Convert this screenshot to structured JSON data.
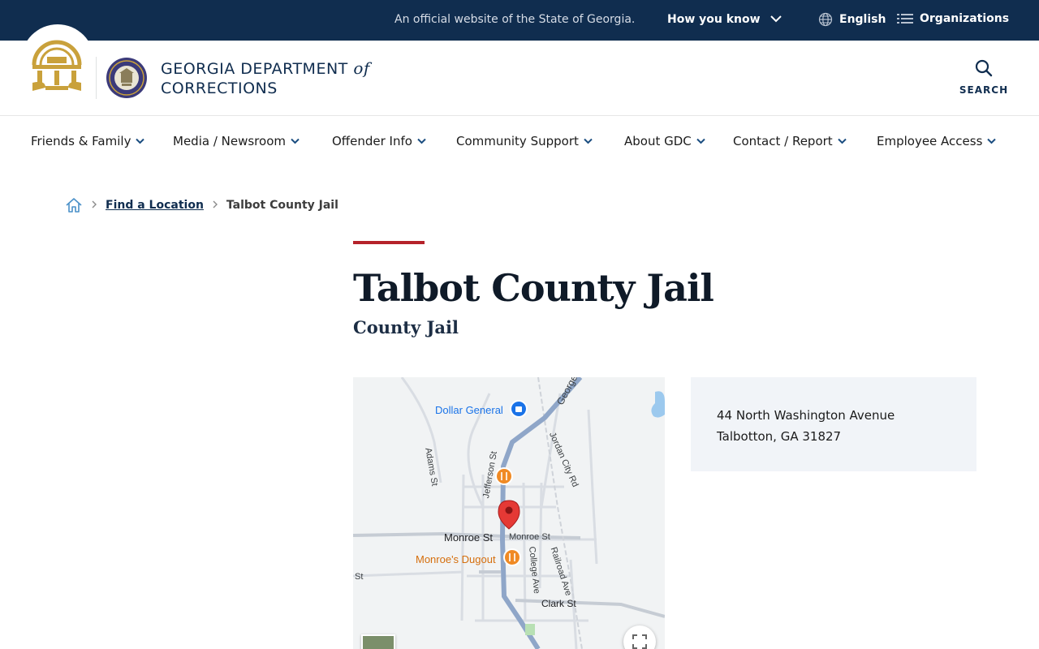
{
  "topbar": {
    "official_text": "An official website of the State of Georgia.",
    "how_you_know": "How you know",
    "language": "English",
    "organizations": "Organizations"
  },
  "header": {
    "agency_line1": "GEORGIA DEPARTMENT",
    "agency_of": "of",
    "agency_line2": "CORRECTIONS",
    "search_label": "SEARCH"
  },
  "nav": {
    "items": [
      {
        "label": "Friends & Family"
      },
      {
        "label": "Media / Newsroom"
      },
      {
        "label": "Offender Info"
      },
      {
        "label": "Community Support"
      },
      {
        "label": "About GDC"
      },
      {
        "label": "Contact / Report"
      },
      {
        "label": "Employee Access"
      }
    ]
  },
  "breadcrumb": {
    "parent": "Find a Location",
    "current": "Talbot County Jail"
  },
  "page": {
    "title": "Talbot County Jail",
    "subtitle": "County Jail"
  },
  "map": {
    "labels": {
      "dollar_general": "Dollar General",
      "george_w": "George W",
      "jordan_city_rd": "Jordan City Rd",
      "adams_st": "Adams St",
      "jefferson_st": "Jefferson St",
      "monroe_st_main": "Monroe St",
      "monroe_st_small": "Monroe St",
      "monroes_dugout": "Monroe's Dugout",
      "college_ave": "College Ave",
      "railroad_ave": "Railroad Ave",
      "clark_st": "Clark St",
      "st_left": "St"
    }
  },
  "address": {
    "line1": "44 North Washington Avenue",
    "line2": "Talbotton, GA 31827"
  },
  "colors": {
    "topbar_bg": "#102d4f",
    "accent_red": "#b5222a",
    "gold": "#c9a13b",
    "card_bg": "#f1f4f8"
  }
}
